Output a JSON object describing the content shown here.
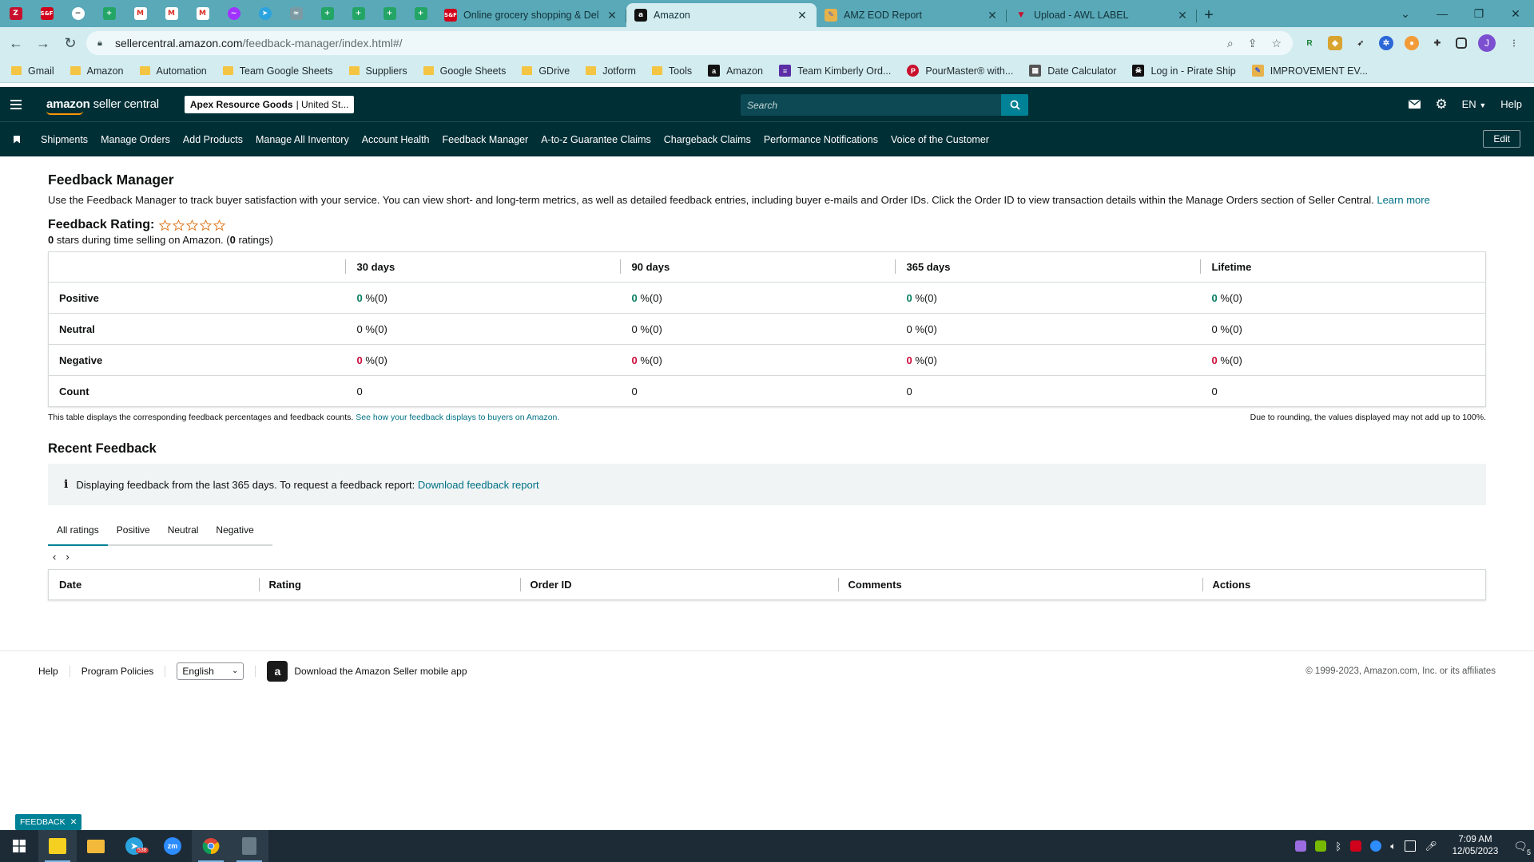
{
  "browser": {
    "tabs": [
      {
        "title": "Online grocery shopping & Deli",
        "active": false
      },
      {
        "title": "Amazon",
        "active": true
      },
      {
        "title": "AMZ EOD Report",
        "active": false
      },
      {
        "title": "Upload - AWL LABEL",
        "active": false
      }
    ],
    "mini_tab_labels": [
      "S&F"
    ],
    "url_host": "sellercentral.amazon.com",
    "url_path": "/feedback-manager/index.html#/",
    "profile_initial": "J",
    "bookmarks": [
      {
        "label": "Gmail",
        "type": "folder"
      },
      {
        "label": "Amazon",
        "type": "folder"
      },
      {
        "label": "Automation",
        "type": "folder"
      },
      {
        "label": "Team Google Sheets",
        "type": "folder"
      },
      {
        "label": "Suppliers",
        "type": "folder"
      },
      {
        "label": "Google Sheets",
        "type": "folder"
      },
      {
        "label": "GDrive",
        "type": "folder"
      },
      {
        "label": "Jotform",
        "type": "folder"
      },
      {
        "label": "Tools",
        "type": "folder"
      },
      {
        "label": "Amazon",
        "type": "site"
      },
      {
        "label": "Team Kimberly Ord...",
        "type": "site"
      },
      {
        "label": "PourMaster® with...",
        "type": "site"
      },
      {
        "label": "Date Calculator",
        "type": "site"
      },
      {
        "label": "Log in - Pirate Ship",
        "type": "site"
      },
      {
        "label": "IMPROVEMENT EV...",
        "type": "site"
      }
    ]
  },
  "header": {
    "logo_brand": "amazon",
    "logo_suffix": "seller central",
    "store_name": "Apex Resource Goods",
    "store_region": "| United St...",
    "search_placeholder": "Search",
    "language": "EN",
    "help": "Help"
  },
  "nav": {
    "items": [
      "Shipments",
      "Manage Orders",
      "Add Products",
      "Manage All Inventory",
      "Account Health",
      "Feedback Manager",
      "A-to-z Guarantee Claims",
      "Chargeback Claims",
      "Performance Notifications",
      "Voice of the Customer"
    ],
    "edit": "Edit"
  },
  "page": {
    "title": "Feedback Manager",
    "description": "Use the Feedback Manager to track buyer satisfaction with your service. You can view short- and long-term metrics, as well as detailed feedback entries, including buyer e-mails and Order IDs. Click the Order ID to view transaction details within the Manage Orders section of Seller Central.",
    "learn_more": "Learn more",
    "rating_title": "Feedback Rating:",
    "stars_count": "0",
    "stars_text": " stars during time selling on Amazon. (",
    "ratings_count": "0",
    "ratings_text": " ratings)"
  },
  "metrics": {
    "columns": [
      "30 days",
      "90 days",
      "365 days",
      "Lifetime"
    ],
    "rows": [
      {
        "label": "Positive",
        "kind": "pos",
        "values": [
          {
            "v": "0",
            "s": " %(0)"
          },
          {
            "v": "0",
            "s": " %(0)"
          },
          {
            "v": "0",
            "s": " %(0)"
          },
          {
            "v": "0",
            "s": " %(0)"
          }
        ]
      },
      {
        "label": "Neutral",
        "kind": "neu",
        "values": [
          {
            "v": "0",
            "s": " %(0)"
          },
          {
            "v": "0",
            "s": " %(0)"
          },
          {
            "v": "0",
            "s": " %(0)"
          },
          {
            "v": "0",
            "s": " %(0)"
          }
        ]
      },
      {
        "label": "Negative",
        "kind": "neg",
        "values": [
          {
            "v": "0",
            "s": " %(0)"
          },
          {
            "v": "0",
            "s": " %(0)"
          },
          {
            "v": "0",
            "s": " %(0)"
          },
          {
            "v": "0",
            "s": " %(0)"
          }
        ]
      },
      {
        "label": "Count",
        "kind": "plain",
        "values": [
          {
            "v": "0",
            "s": ""
          },
          {
            "v": "0",
            "s": ""
          },
          {
            "v": "0",
            "s": ""
          },
          {
            "v": "0",
            "s": ""
          }
        ]
      }
    ],
    "note_left": "This table displays the corresponding feedback percentages and feedback counts.",
    "note_link": "See how your feedback displays to buyers on Amazon.",
    "note_right": "Due to rounding, the values displayed may not add up to 100%."
  },
  "recent": {
    "title": "Recent Feedback",
    "info_text": "Displaying feedback from the last 365 days. To request a feedback report:",
    "info_link": "Download feedback report",
    "tabs": [
      "All ratings",
      "Positive",
      "Neutral",
      "Negative"
    ],
    "active_tab": "All ratings",
    "columns": [
      "Date",
      "Rating",
      "Order ID",
      "Comments",
      "Actions"
    ]
  },
  "footer": {
    "help": "Help",
    "policies": "Program Policies",
    "language": "English",
    "app_text": "Download the Amazon Seller mobile app",
    "copyright": "© 1999-2023, Amazon.com, Inc. or its affiliates",
    "feedback_pill": "FEEDBACK"
  },
  "taskbar": {
    "time": "7:09 AM",
    "date": "12/05/2023",
    "telegram_badge": "538",
    "notifications": "5"
  },
  "colors": {
    "teal_header": "#002f36",
    "accent": "#008296",
    "positive": "#067d62",
    "negative": "#cc0c39",
    "tabstrip": "#5aa9b8"
  }
}
